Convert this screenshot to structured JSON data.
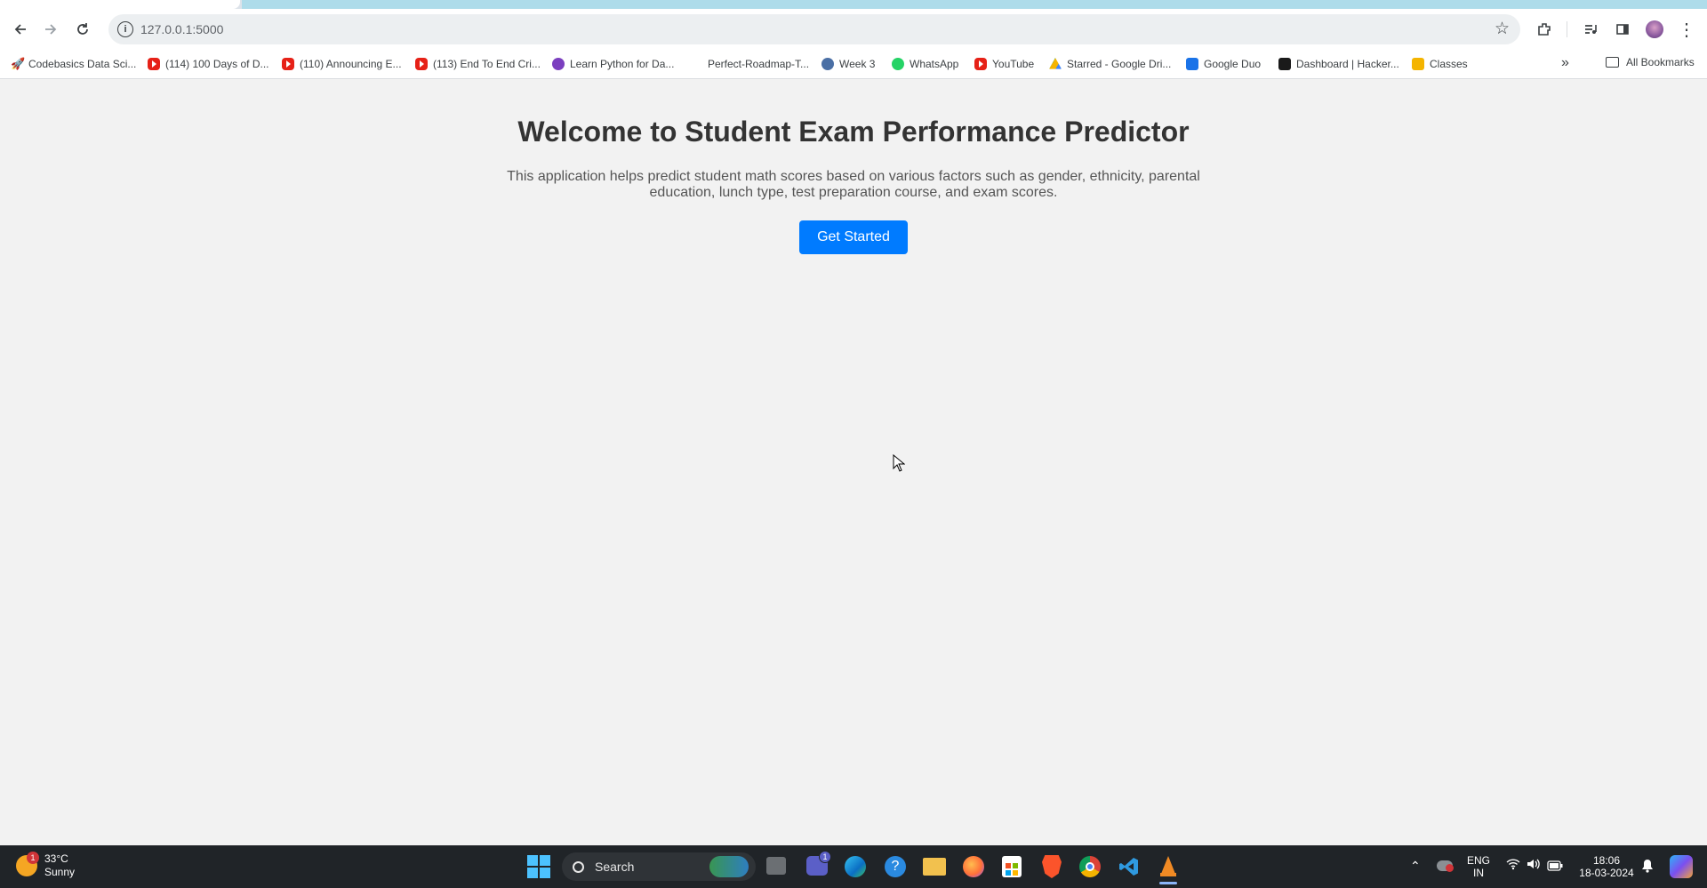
{
  "browser": {
    "url": "127.0.0.1:5000",
    "bookmarks": [
      {
        "label": "Codebasics Data Sci..."
      },
      {
        "label": "(114) 100 Days of D..."
      },
      {
        "label": "(110) Announcing E..."
      },
      {
        "label": "(113) End To End Cri..."
      },
      {
        "label": "Learn Python for Da..."
      },
      {
        "label": "Perfect-Roadmap-T..."
      },
      {
        "label": "Week 3"
      },
      {
        "label": "WhatsApp"
      },
      {
        "label": "YouTube"
      },
      {
        "label": "Starred - Google Dri..."
      },
      {
        "label": "Google Duo"
      },
      {
        "label": "Dashboard | Hacker..."
      },
      {
        "label": "Classes"
      }
    ],
    "all_bookmarks_label": "All Bookmarks",
    "more_label": "»"
  },
  "page": {
    "title": "Welcome to Student Exam Performance Predictor",
    "description": "This application helps predict student math scores based on various factors such as gender, ethnicity, parental education, lunch type, test preparation course, and exam scores.",
    "cta_label": "Get Started",
    "cta_color": "#007bff"
  },
  "taskbar": {
    "weather_temp": "33°C",
    "weather_desc": "Sunny",
    "weather_badge": "1",
    "search_label": "Search",
    "chat_badge": "1",
    "lang_line1": "ENG",
    "lang_line2": "IN",
    "time": "18:06",
    "date": "18-03-2024"
  }
}
